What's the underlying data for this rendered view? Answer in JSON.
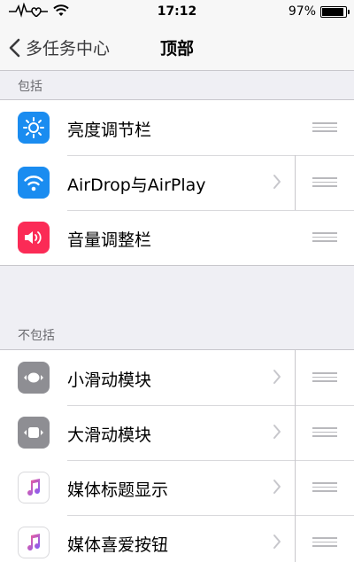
{
  "status": {
    "time": "17:12",
    "battery_text": "97%",
    "battery_level": 0.97
  },
  "nav": {
    "back_label": "多任务中心",
    "title": "顶部"
  },
  "included": {
    "header": "包括",
    "items": [
      {
        "label": "亮度调节栏",
        "icon": "sun-icon",
        "color": "#1a8cf0",
        "has_chevron": false
      },
      {
        "label": "AirDrop与AirPlay",
        "icon": "wifi-icon",
        "color": "#1a8cf0",
        "has_chevron": true
      },
      {
        "label": "音量调整栏",
        "icon": "speaker-icon",
        "color": "#fb2b56",
        "has_chevron": false
      }
    ]
  },
  "excluded": {
    "header": "不包括",
    "items": [
      {
        "label": "小滑动模块",
        "icon": "small-slider-icon",
        "color": "#8e8e93",
        "has_chevron": true
      },
      {
        "label": "大滑动模块",
        "icon": "large-slider-icon",
        "color": "#8e8e93",
        "has_chevron": true
      },
      {
        "label": "媒体标题显示",
        "icon": "music-note-icon",
        "color": "#ffffff",
        "has_chevron": true
      },
      {
        "label": "媒体喜爱按钮",
        "icon": "music-note-icon",
        "color": "#ffffff",
        "has_chevron": true
      }
    ]
  }
}
